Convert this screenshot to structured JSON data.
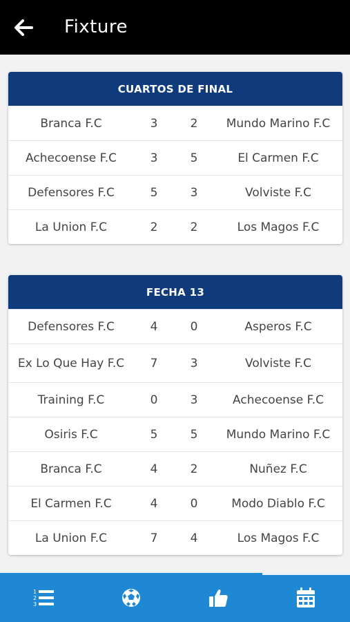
{
  "appbar": {
    "title": "Fixture"
  },
  "sections": [
    {
      "title": "CUARTOS DE FINAL",
      "matches": [
        {
          "home": "Branca F.C",
          "home_score": "3",
          "away_score": "2",
          "away": "Mundo Marino F.C"
        },
        {
          "home": "Achecoense F.C",
          "home_score": "3",
          "away_score": "5",
          "away": "El Carmen F.C"
        },
        {
          "home": "Defensores F.C",
          "home_score": "5",
          "away_score": "3",
          "away": "Volviste F.C"
        },
        {
          "home": "La Union F.C",
          "home_score": "2",
          "away_score": "2",
          "away": "Los Magos F.C"
        }
      ]
    },
    {
      "title": "FECHA 13",
      "matches": [
        {
          "home": "Defensores F.C",
          "home_score": "4",
          "away_score": "0",
          "away": "Asperos F.C"
        },
        {
          "home": "Ex Lo Que Hay F.C",
          "home_score": "7",
          "away_score": "3",
          "away": "Volviste F.C"
        },
        {
          "home": "Training F.C",
          "home_score": "0",
          "away_score": "3",
          "away": "Achecoense F.C"
        },
        {
          "home": "Osiris F.C",
          "home_score": "5",
          "away_score": "5",
          "away": "Mundo Marino F.C"
        },
        {
          "home": "Branca F.C",
          "home_score": "4",
          "away_score": "2",
          "away": "Nuñez F.C"
        },
        {
          "home": "El Carmen F.C",
          "home_score": "4",
          "away_score": "0",
          "away": "Modo Diablo F.C"
        },
        {
          "home": "La Union F.C",
          "home_score": "7",
          "away_score": "4",
          "away": "Los Magos F.C"
        }
      ]
    }
  ],
  "bottom_nav": {
    "items": [
      {
        "icon": "list-numbered-icon"
      },
      {
        "icon": "soccer-ball-icon"
      },
      {
        "icon": "thumbs-up-icon"
      },
      {
        "icon": "calendar-icon",
        "selected": true
      }
    ]
  },
  "colors": {
    "appbar": "#000000",
    "header": "#0f3b7c",
    "nav": "#1e88d4"
  }
}
